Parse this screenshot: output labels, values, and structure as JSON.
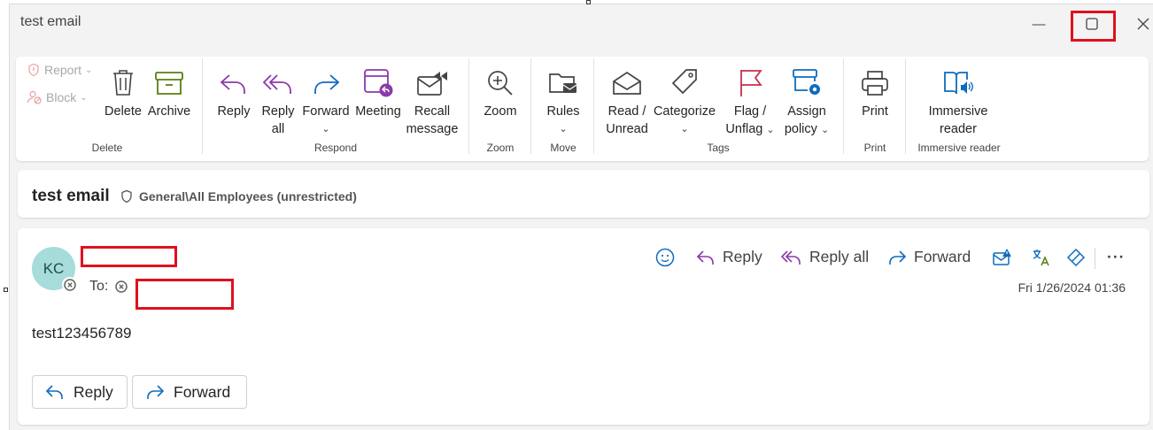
{
  "window": {
    "title": "test email",
    "minimize_glyph": "—",
    "maximize_glyph": "▢",
    "close_glyph": "✕"
  },
  "ribbon": {
    "delete_group": {
      "report_label": "Report",
      "block_label": "Block",
      "delete_label": "Delete",
      "archive_label": "Archive",
      "group_label": "Delete"
    },
    "respond_group": {
      "reply_label": "Reply",
      "reply_all_line1": "Reply",
      "reply_all_line2": "all",
      "forward_label": "Forward",
      "meeting_label": "Meeting",
      "recall_line1": "Recall",
      "recall_line2": "message",
      "group_label": "Respond"
    },
    "zoom_group": {
      "zoom_label": "Zoom",
      "group_label": "Zoom"
    },
    "move_group": {
      "rules_label": "Rules",
      "group_label": "Move"
    },
    "tags_group": {
      "read_line1": "Read /",
      "read_line2": "Unread",
      "categorize_label": "Categorize",
      "flag_line1": "Flag /",
      "flag_line2": "Unflag",
      "assign_line1": "Assign",
      "assign_line2": "policy",
      "group_label": "Tags"
    },
    "print_group": {
      "print_label": "Print",
      "group_label": "Print"
    },
    "immersive_group": {
      "immersive_line1": "Immersive",
      "immersive_line2": "reader",
      "group_label": "Immersive reader"
    },
    "chevron": "⌄"
  },
  "subject_bar": {
    "subject": "test email",
    "sensitivity_label": "General\\All Employees (unrestricted)"
  },
  "message": {
    "avatar_initials": "KC",
    "to_label": "To:",
    "reply_label": "Reply",
    "reply_all_label": "Reply all",
    "forward_label": "Forward",
    "more_glyph": "···",
    "date": "Fri 1/26/2024 01:36",
    "body_text": "test123456789",
    "bottom_reply_label": "Reply",
    "bottom_forward_label": "Forward"
  },
  "colors": {
    "accent_blue": "#0f6cbd",
    "purple": "#8a3aa9",
    "green": "#5c7e10",
    "flag_red": "#c4314b",
    "highlight_red": "#e0101e",
    "avatar_bg": "#a6dcd9"
  }
}
